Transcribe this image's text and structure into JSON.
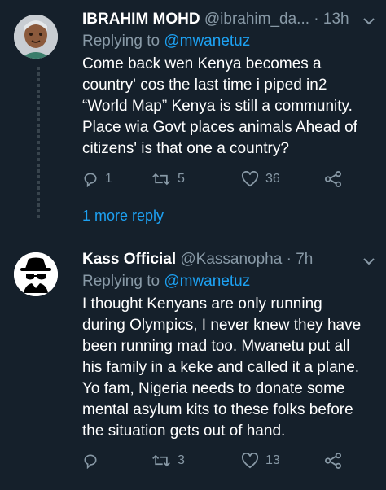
{
  "tweets": [
    {
      "name": "IBRAHIM MOHD",
      "handle": "@ibrahim_da...",
      "time": "· 13h",
      "reply_prefix": "Replying to",
      "reply_to": "@mwanetuz",
      "text": "Come back wen Kenya becomes a\ncountry' cos the last time i piped in2\n“World Map” Kenya is still a community.\nPlace wia Govt places animals Ahead of\ncitizens' is that one a country?",
      "replies": "1",
      "retweets": "5",
      "likes": "36",
      "more_replies": "1 more reply"
    },
    {
      "name": "Kass Official",
      "handle": "@Kassanopha",
      "time": "· 7h",
      "reply_prefix": "Replying to",
      "reply_to": "@mwanetuz",
      "text": "I thought Kenyans are only running\nduring Olympics, I never knew they have\nbeen running mad too. Mwanetu put all\nhis family in a keke and called it a plane.\nYo fam, Nigeria needs to donate some\nmental asylum kits to these folks before\nthe situation gets out of hand.",
      "replies": "",
      "retweets": "3",
      "likes": "13"
    }
  ],
  "icons": {
    "reply": "reply-icon",
    "retweet": "retweet-icon",
    "like": "heart-icon",
    "share": "share-icon",
    "menu": "chevron-down-icon"
  },
  "colors": {
    "background": "#15202b",
    "accent": "#1da1f2",
    "muted": "#8899a6"
  }
}
